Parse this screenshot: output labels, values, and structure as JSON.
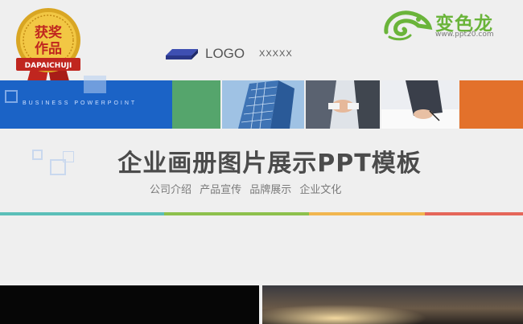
{
  "badge": {
    "line1": "获奖",
    "line2": "作品",
    "ribbon": "DAPAICHUJI"
  },
  "brand": {
    "name": "变色龙",
    "url": "www.ppt20.com"
  },
  "logo": {
    "text": "LOGO",
    "sub": "XXXXX"
  },
  "strip": {
    "tagline": "BUSINESS POWERPOINT"
  },
  "title": "企业画册图片展示PPT模板",
  "subtitle": "公司介绍 产品宣传 品牌展示 企业文化",
  "colors": {
    "blue": "#1b63c6",
    "green": "#55a56c",
    "orange": "#e3712b",
    "teal": "#5bbfb8",
    "lime": "#8dc04c",
    "yellow": "#f1b64f",
    "red": "#e5665a"
  }
}
